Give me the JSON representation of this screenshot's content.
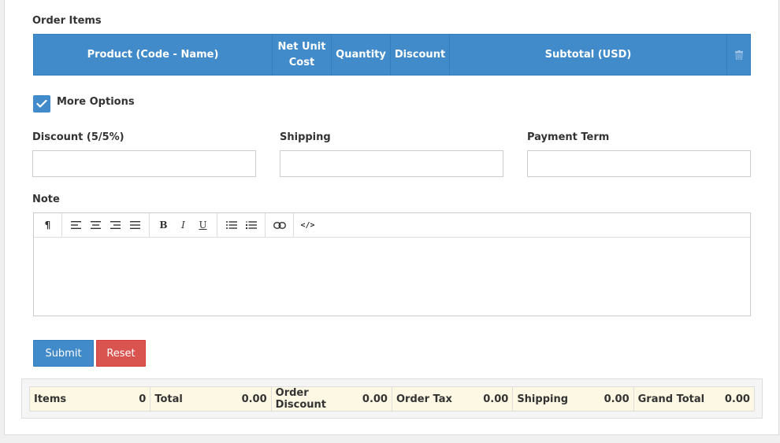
{
  "order_items": {
    "title": "Order Items",
    "columns": [
      "Product (Code - Name)",
      "Net Unit\nCost",
      "Quantity",
      "Discount",
      "Subtotal (USD)"
    ],
    "delete_icon": "trash-icon"
  },
  "more_options": {
    "label": "More Options",
    "checked": true
  },
  "fields": {
    "discount": {
      "label": "Discount (5/5%)",
      "value": ""
    },
    "shipping": {
      "label": "Shipping",
      "value": ""
    },
    "payment_term": {
      "label": "Payment Term",
      "value": ""
    }
  },
  "note": {
    "label": "Note",
    "value": ""
  },
  "editor_toolbar": {
    "paragraph": "¶",
    "bold": "B",
    "italic": "I",
    "underline": "U",
    "code": "</>"
  },
  "buttons": {
    "submit": "Submit",
    "reset": "Reset"
  },
  "totals": {
    "items_label": "Items",
    "items_value": "0",
    "total_label": "Total",
    "total_value": "0.00",
    "order_discount_label": "Order Discount",
    "order_discount_value": "0.00",
    "order_tax_label": "Order Tax",
    "order_tax_value": "0.00",
    "shipping_label": "Shipping",
    "shipping_value": "0.00",
    "grand_total_label": "Grand Total",
    "grand_total_value": "0.00"
  },
  "colors": {
    "primary": "#428bca",
    "danger": "#d9534f",
    "totals_bg": "#fcf8e3"
  }
}
